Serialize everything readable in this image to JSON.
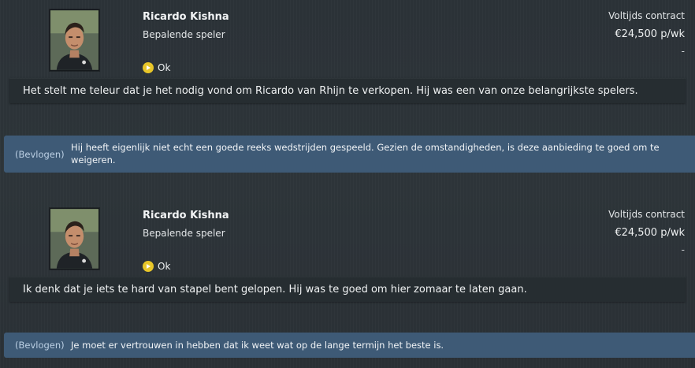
{
  "conversations": [
    {
      "player": {
        "name": "Ricardo Kishna",
        "role": "Bepalende speler",
        "mood_icon": "happy-mood-icon",
        "mood_label": "Ok",
        "contract": "Voltijds contract",
        "wage": "€24,500 p/wk",
        "extra": "-"
      },
      "statement": "Het stelt me teleur dat je het nodig vond om Ricardo van Rhijn te verkopen. Hij was een van onze belangrijkste spelers.",
      "reply": {
        "tag": "(Bevlogen)",
        "text": "Hij heeft eigenlijk niet echt een goede reeks wedstrijden gespeeld. Gezien de omstandigheden, is deze aanbieding te goed om te weigeren."
      }
    },
    {
      "player": {
        "name": "Ricardo Kishna",
        "role": "Bepalende speler",
        "mood_icon": "happy-mood-icon",
        "mood_label": "Ok",
        "contract": "Voltijds contract",
        "wage": "€24,500 p/wk",
        "extra": "-"
      },
      "statement": "Ik denk dat je iets te hard van stapel bent gelopen. Hij was te goed om hier zomaar te laten gaan.",
      "reply": {
        "tag": "(Bevlogen)",
        "text": "Je moet er vertrouwen in hebben dat ik weet wat op de lange termijn het beste is."
      }
    }
  ],
  "colors": {
    "background": "#2b3237",
    "reply_bubble": "#3e5a76",
    "mood_icon": "#e8c629"
  }
}
